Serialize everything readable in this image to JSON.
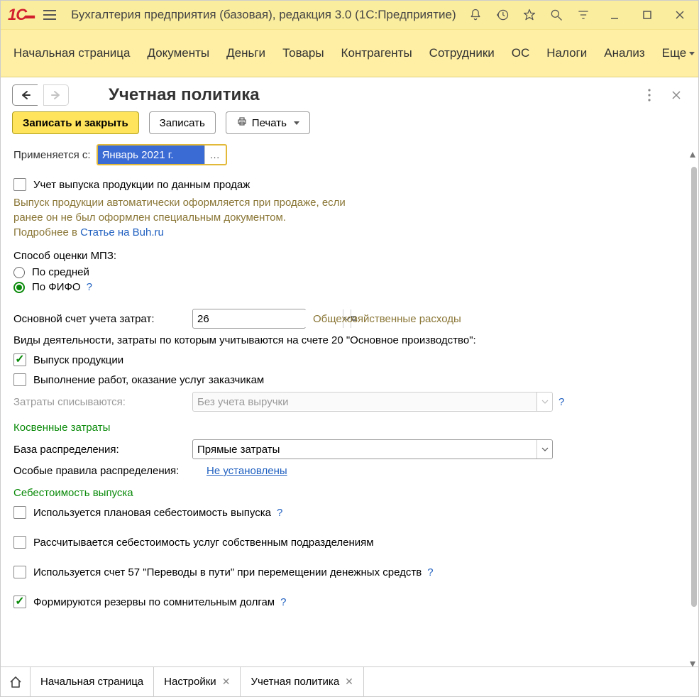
{
  "titlebar": {
    "app_title": "Бухгалтерия предприятия (базовая), редакция 3.0  (1С:Предприятие)"
  },
  "menubar": {
    "items": [
      "Начальная страница",
      "Документы",
      "Деньги",
      "Товары",
      "Контрагенты",
      "Сотрудники",
      "ОС",
      "Налоги",
      "Анализ"
    ],
    "more": "Еще"
  },
  "header": {
    "title": "Учетная политика"
  },
  "toolbar": {
    "write_close": "Записать и закрыть",
    "write": "Записать",
    "print": "Печать"
  },
  "form": {
    "applies_from_label": "Применяется с:",
    "applies_from_value": "Январь 2021 г.",
    "chk_accounting_output_by_sales": "Учет выпуска продукции по данным продаж",
    "hint_output": "Выпуск продукции автоматически оформляется при продаже, если\nранее он не был оформлен специальным документом.\nПодробнее в ",
    "hint_link": "Статье на Buh.ru",
    "mpz_label": "Способ оценки МПЗ:",
    "mpz_avg": "По средней",
    "mpz_fifo": "По ФИФО",
    "main_cost_account_label": "Основной счет учета затрат:",
    "main_cost_account_value": "26",
    "main_cost_account_hint": "Общехозяйственные расходы",
    "activities_label": "Виды деятельности, затраты по которым учитываются на счете 20 \"Основное производство\":",
    "chk_production": "Выпуск продукции",
    "chk_services": "Выполнение работ, оказание услуг заказчикам",
    "costs_writeoff_label": "Затраты списываются:",
    "costs_writeoff_value": "Без учета выручки",
    "indirect_section": "Косвенные затраты",
    "dist_base_label": "База распределения:",
    "dist_base_value": "Прямые затраты",
    "special_rules_label": "Особые правила распределения:",
    "special_rules_link": "Не установлены",
    "cost_section": "Себестоимость выпуска",
    "chk_plan_cost": "Используется плановая себестоимость выпуска",
    "chk_internal_services": "Рассчитывается себестоимость услуг собственным подразделениям",
    "chk_account57": "Используется счет 57 \"Переводы в пути\" при перемещении денежных средств",
    "chk_reserves": "Формируются резервы по сомнительным долгам"
  },
  "bottom_tabs": {
    "t0": "Начальная страница",
    "t1": "Настройки",
    "t2": "Учетная политика"
  }
}
